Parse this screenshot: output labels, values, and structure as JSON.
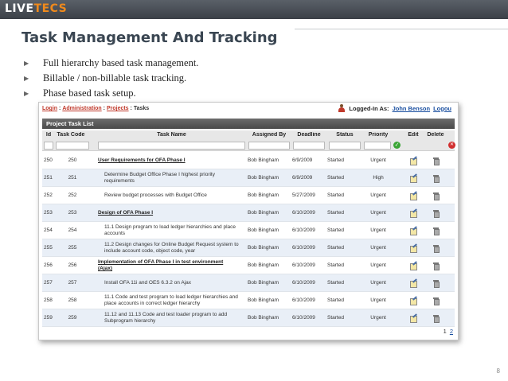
{
  "brand": {
    "logo_main": "LIVE",
    "logo_accent": "TECS"
  },
  "slide": {
    "title": "Task Management And Tracking",
    "bullets": [
      "Full hierarchy based task management.",
      "Billable / non-billable task tracking.",
      "Phase based task setup."
    ]
  },
  "app": {
    "breadcrumb": {
      "login": "Login",
      "administration": "Administration",
      "projects": "Projects",
      "current": "Tasks",
      "sep": ":"
    },
    "logged_in_label": "Logged-In As:",
    "user_name": "John Benson",
    "logout": "Logou",
    "table_title": "Project Task List",
    "columns": [
      "Id",
      "Task Code",
      "Task Name",
      "Assigned By",
      "Deadline",
      "Status",
      "Priority",
      "Edit",
      "Delete"
    ],
    "rows": [
      {
        "id": "250",
        "code": "250",
        "name": "User Requirements for OFA Phase I",
        "phase": true,
        "assigned_by": "Bob Bingham",
        "deadline": "6/9/2009",
        "status": "Started",
        "priority": "Urgent"
      },
      {
        "id": "251",
        "code": "251",
        "name": "Determine Budget Office Phase I highest priority requirements",
        "phase": false,
        "assigned_by": "Bob Bingham",
        "deadline": "6/9/2009",
        "status": "Started",
        "priority": "High"
      },
      {
        "id": "252",
        "code": "252",
        "name": "Review budget processes with Budget Office",
        "phase": false,
        "assigned_by": "Bob Bingham",
        "deadline": "5/27/2009",
        "status": "Started",
        "priority": "Urgent"
      },
      {
        "id": "253",
        "code": "253",
        "name": "Design of OFA Phase I",
        "phase": true,
        "assigned_by": "Bob Bingham",
        "deadline": "6/10/2009",
        "status": "Started",
        "priority": "Urgent"
      },
      {
        "id": "254",
        "code": "254",
        "name": "11.1 Design program to load ledger hierarchies and place accounts",
        "phase": false,
        "assigned_by": "Bob Bingham",
        "deadline": "6/10/2009",
        "status": "Started",
        "priority": "Urgent"
      },
      {
        "id": "255",
        "code": "255",
        "name": "11.2 Design changes for Online Budget Request system to include account code, object code, year",
        "phase": false,
        "assigned_by": "Bob Bingham",
        "deadline": "6/10/2009",
        "status": "Started",
        "priority": "Urgent"
      },
      {
        "id": "256",
        "code": "256",
        "name": "Implementation of OFA Phase I in test environment (Ajax)",
        "phase": true,
        "assigned_by": "Bob Bingham",
        "deadline": "6/10/2009",
        "status": "Started",
        "priority": "Urgent"
      },
      {
        "id": "257",
        "code": "257",
        "name": "Install OFA 11i and OES 6.3.2 on Ajax",
        "phase": false,
        "assigned_by": "Bob Bingham",
        "deadline": "6/10/2009",
        "status": "Started",
        "priority": "Urgent"
      },
      {
        "id": "258",
        "code": "258",
        "name": "11.1 Code and test program to load ledger hierarchies and place accounts in correct ledger hierarchy",
        "phase": false,
        "assigned_by": "Bob Bingham",
        "deadline": "6/10/2009",
        "status": "Started",
        "priority": "Urgent"
      },
      {
        "id": "259",
        "code": "259",
        "name": "11.12 and 11.13 Code and test loader program to add Subprogram hierarchy",
        "phase": false,
        "assigned_by": "Bob Bingham",
        "deadline": "6/10/2009",
        "status": "Started",
        "priority": "Urgent"
      }
    ],
    "pager": {
      "page1": "1",
      "page2": "2"
    }
  },
  "slide_number": "8"
}
